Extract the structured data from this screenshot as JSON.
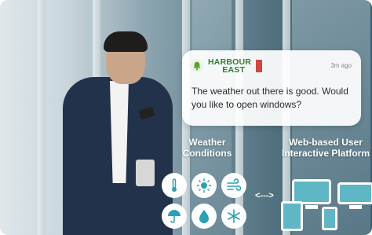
{
  "notification": {
    "brand_line1": "HARBOUR",
    "brand_line2": "EAST",
    "time": "3m ago",
    "message": "The weather out there is good. Would you like to open windows?"
  },
  "labels": {
    "weather": "Weather Conditions",
    "platform": "Web-based User Interactive Platform"
  },
  "connector": "<--->",
  "icons": [
    "thermometer-icon",
    "sun-icon",
    "wind-icon",
    "umbrella-icon",
    "water-drop-icon",
    "snowflake-icon"
  ],
  "colors": {
    "accent": "#5fb6c5",
    "brand": "#2e7d32"
  }
}
